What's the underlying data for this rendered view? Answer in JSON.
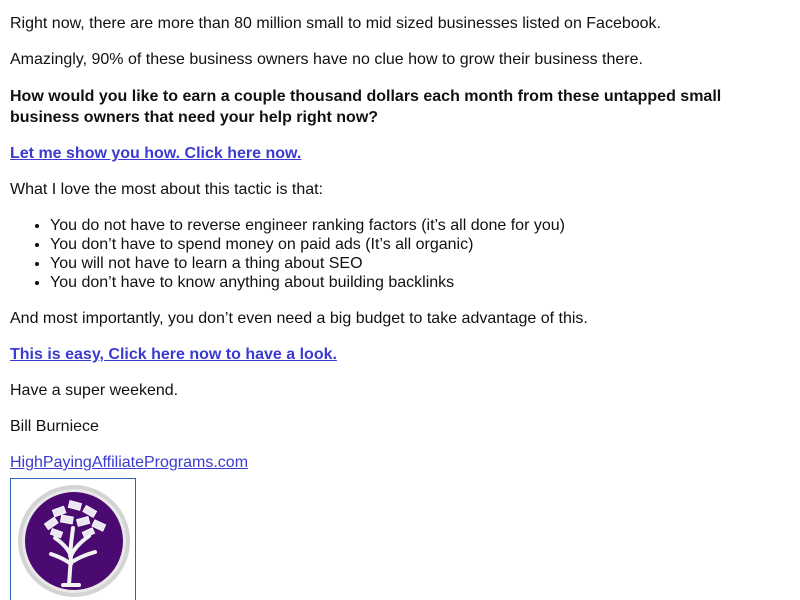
{
  "email": {
    "p1": "Right now, there are more than 80 million small to mid sized businesses listed on Facebook.",
    "p2": "Amazingly, 90% of these business owners have no clue how to grow their business there.",
    "p3_bold": "How would you like to earn a couple thousand dollars each month from these untapped small business owners that need your help right now?",
    "cta1": "Let me show you how. Click here now.",
    "p4": "What I love the most about this tactic is that:",
    "bullets": [
      "You do not have to reverse engineer ranking factors (it’s all done for you)",
      "You don’t have to spend money on paid ads (It’s all organic)",
      "You will not have to learn a thing about SEO",
      "You don’t have to know anything about building backlinks"
    ],
    "p5": "And most importantly, you don’t even need a big budget to take advantage of this.",
    "cta2": "This is easy, Click here now to have a look.",
    "signoff": "Have a super weekend.",
    "signature": "Bill Burniece",
    "site_link": "HighPayingAffiliatePrograms.com",
    "logo_icon": "tree-with-money-leaves-icon"
  },
  "colors": {
    "link": "#3b3bd0",
    "logo_purple": "#4b0a72",
    "logo_ring": "#c8c8c8",
    "image_border": "#2a64b8"
  }
}
